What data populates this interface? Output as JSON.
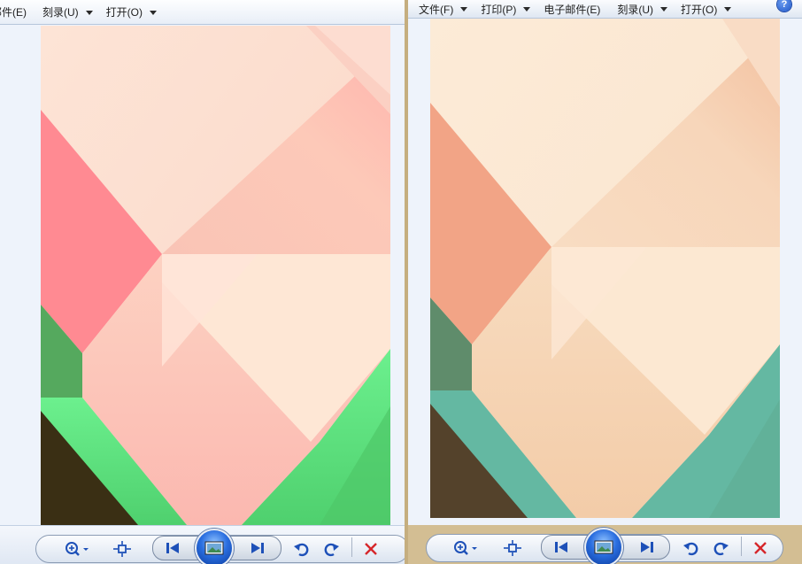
{
  "left_window": {
    "menu": [
      {
        "label": "邮件(E)",
        "has_dropdown": false
      },
      {
        "label": "刻录(U)",
        "has_dropdown": true
      },
      {
        "label": "打开(O)",
        "has_dropdown": true
      }
    ]
  },
  "right_window": {
    "menu": [
      {
        "label": "文件(F)",
        "has_dropdown": true
      },
      {
        "label": "打印(P)",
        "has_dropdown": true
      },
      {
        "label": "电子邮件(E)",
        "has_dropdown": false
      },
      {
        "label": "刻录(U)",
        "has_dropdown": true
      },
      {
        "label": "打开(O)",
        "has_dropdown": true
      }
    ],
    "help_label": "?"
  },
  "toolbar_icons": {
    "zoom": "zoom-icon",
    "fit": "fit-window-icon",
    "previous": "previous-icon",
    "slideshow": "slideshow-icon",
    "next": "next-icon",
    "rotate_left": "rotate-counterclockwise-icon",
    "rotate_right": "rotate-clockwise-icon",
    "delete": "delete-icon"
  },
  "colors": {
    "left_pink": "#ff8a92",
    "left_green": "#6cf08e",
    "left_dark": "#3a2f14",
    "right_orange": "#f2a486",
    "right_teal": "#64b8a2",
    "right_dark": "#54422b",
    "delete_red": "#d6262a",
    "icon_blue": "#1d50b8"
  }
}
